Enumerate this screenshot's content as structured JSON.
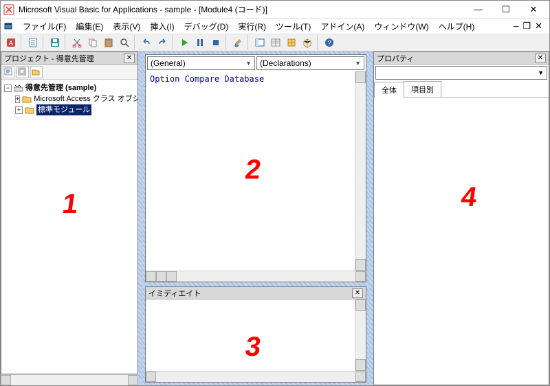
{
  "title": "Microsoft Visual Basic for Applications - sample - [Module4 (コード)]",
  "menus": {
    "file": "ファイル(F)",
    "edit": "編集(E)",
    "view": "表示(V)",
    "insert": "挿入(I)",
    "debug": "デバッグ(D)",
    "run": "実行(R)",
    "tools": "ツール(T)",
    "addin": "アドイン(A)",
    "window": "ウィンドウ(W)",
    "help": "ヘルプ(H)"
  },
  "panels": {
    "project_title": "プロジェクト - 得意先管理",
    "immediate_title": "イミディエイト",
    "properties_title": "プロパティ"
  },
  "tree": {
    "root": "得意先管理 (sample)",
    "item1": "Microsoft Access クラス オブジェ",
    "item2": "標準モジュール"
  },
  "code": {
    "combo_general": "(General)",
    "combo_decl": "(Declarations)",
    "text": "Option Compare Database"
  },
  "props": {
    "tab_all": "全体",
    "tab_cat": "項目別"
  },
  "overlay": {
    "n1": "1",
    "n2": "2",
    "n3": "3",
    "n4": "4"
  }
}
